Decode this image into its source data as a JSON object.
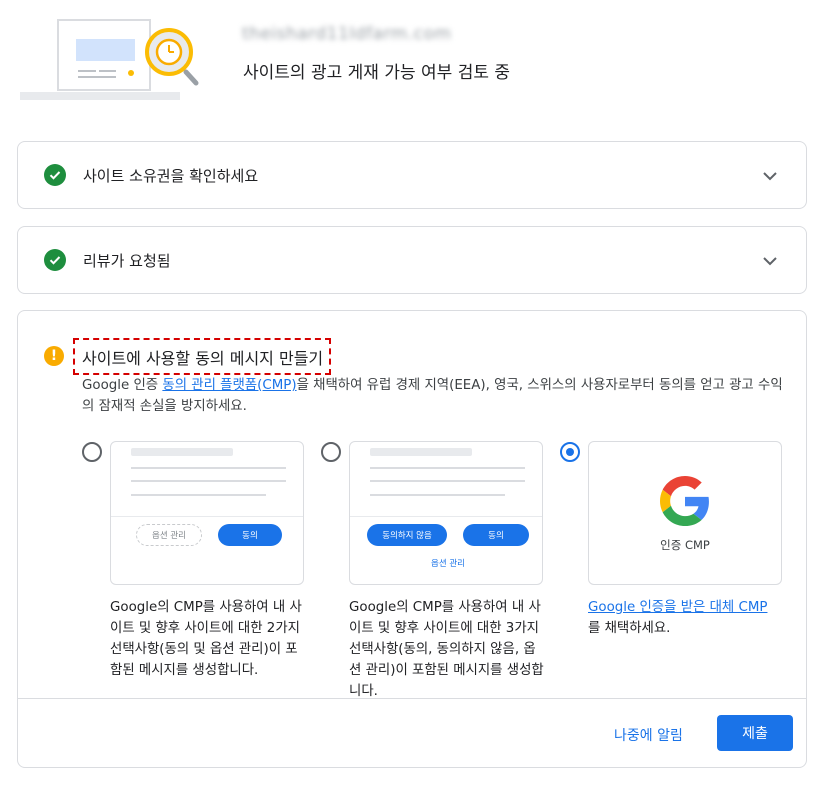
{
  "header": {
    "domain": "theishard11Idfarm.com",
    "subtitle": "사이트의 광고 게재 가능 여부 검토 중"
  },
  "steps": [
    {
      "title": "사이트 소유권을 확인하세요",
      "status": "complete",
      "icon": "check-circle-icon"
    },
    {
      "title": "리뷰가 요청됨",
      "status": "complete",
      "icon": "check-circle-icon"
    }
  ],
  "consent": {
    "title": "사이트에 사용할 동의 메시지 만들기",
    "desc_before": "Google 인증 ",
    "desc_link": "동의 관리 플랫폼(CMP)",
    "desc_after": "을 채택하여 유럽 경제 지역(EEA), 영국, 스위스의 사용자로부터 동의를 얻고 광고 수익의 잠재적 손실을 방지하세요.",
    "options": [
      {
        "selected": false,
        "preview": {
          "manage_label": "옵션 관리",
          "consent_label": "동의"
        },
        "text": "Google의 CMP를 사용하여 내 사이트 및 향후 사이트에 대한 2가지 선택사항(동의 및 옵션 관리)이 포함된 메시지를 생성합니다."
      },
      {
        "selected": false,
        "preview": {
          "decline_label": "동의하지 않음",
          "consent_label": "동의",
          "manage_label": "옵션 관리"
        },
        "text": "Google의 CMP를 사용하여 내 사이트 및 향후 사이트에 대한 3가지 선택사항(동의, 동의하지 않음, 옵션 관리)이 포함된 메시지를 생성합니다."
      },
      {
        "selected": true,
        "preview": {
          "label": "인증 CMP"
        },
        "link": "Google 인증을 받은 대체 CMP",
        "text_after": "를 채택하세요."
      }
    ],
    "later_label": "나중에 알림",
    "submit_label": "제출"
  },
  "colors": {
    "accent": "#1a73e8",
    "success": "#1e8e3e",
    "warning": "#f9ab00",
    "highlight": "#d50000"
  }
}
